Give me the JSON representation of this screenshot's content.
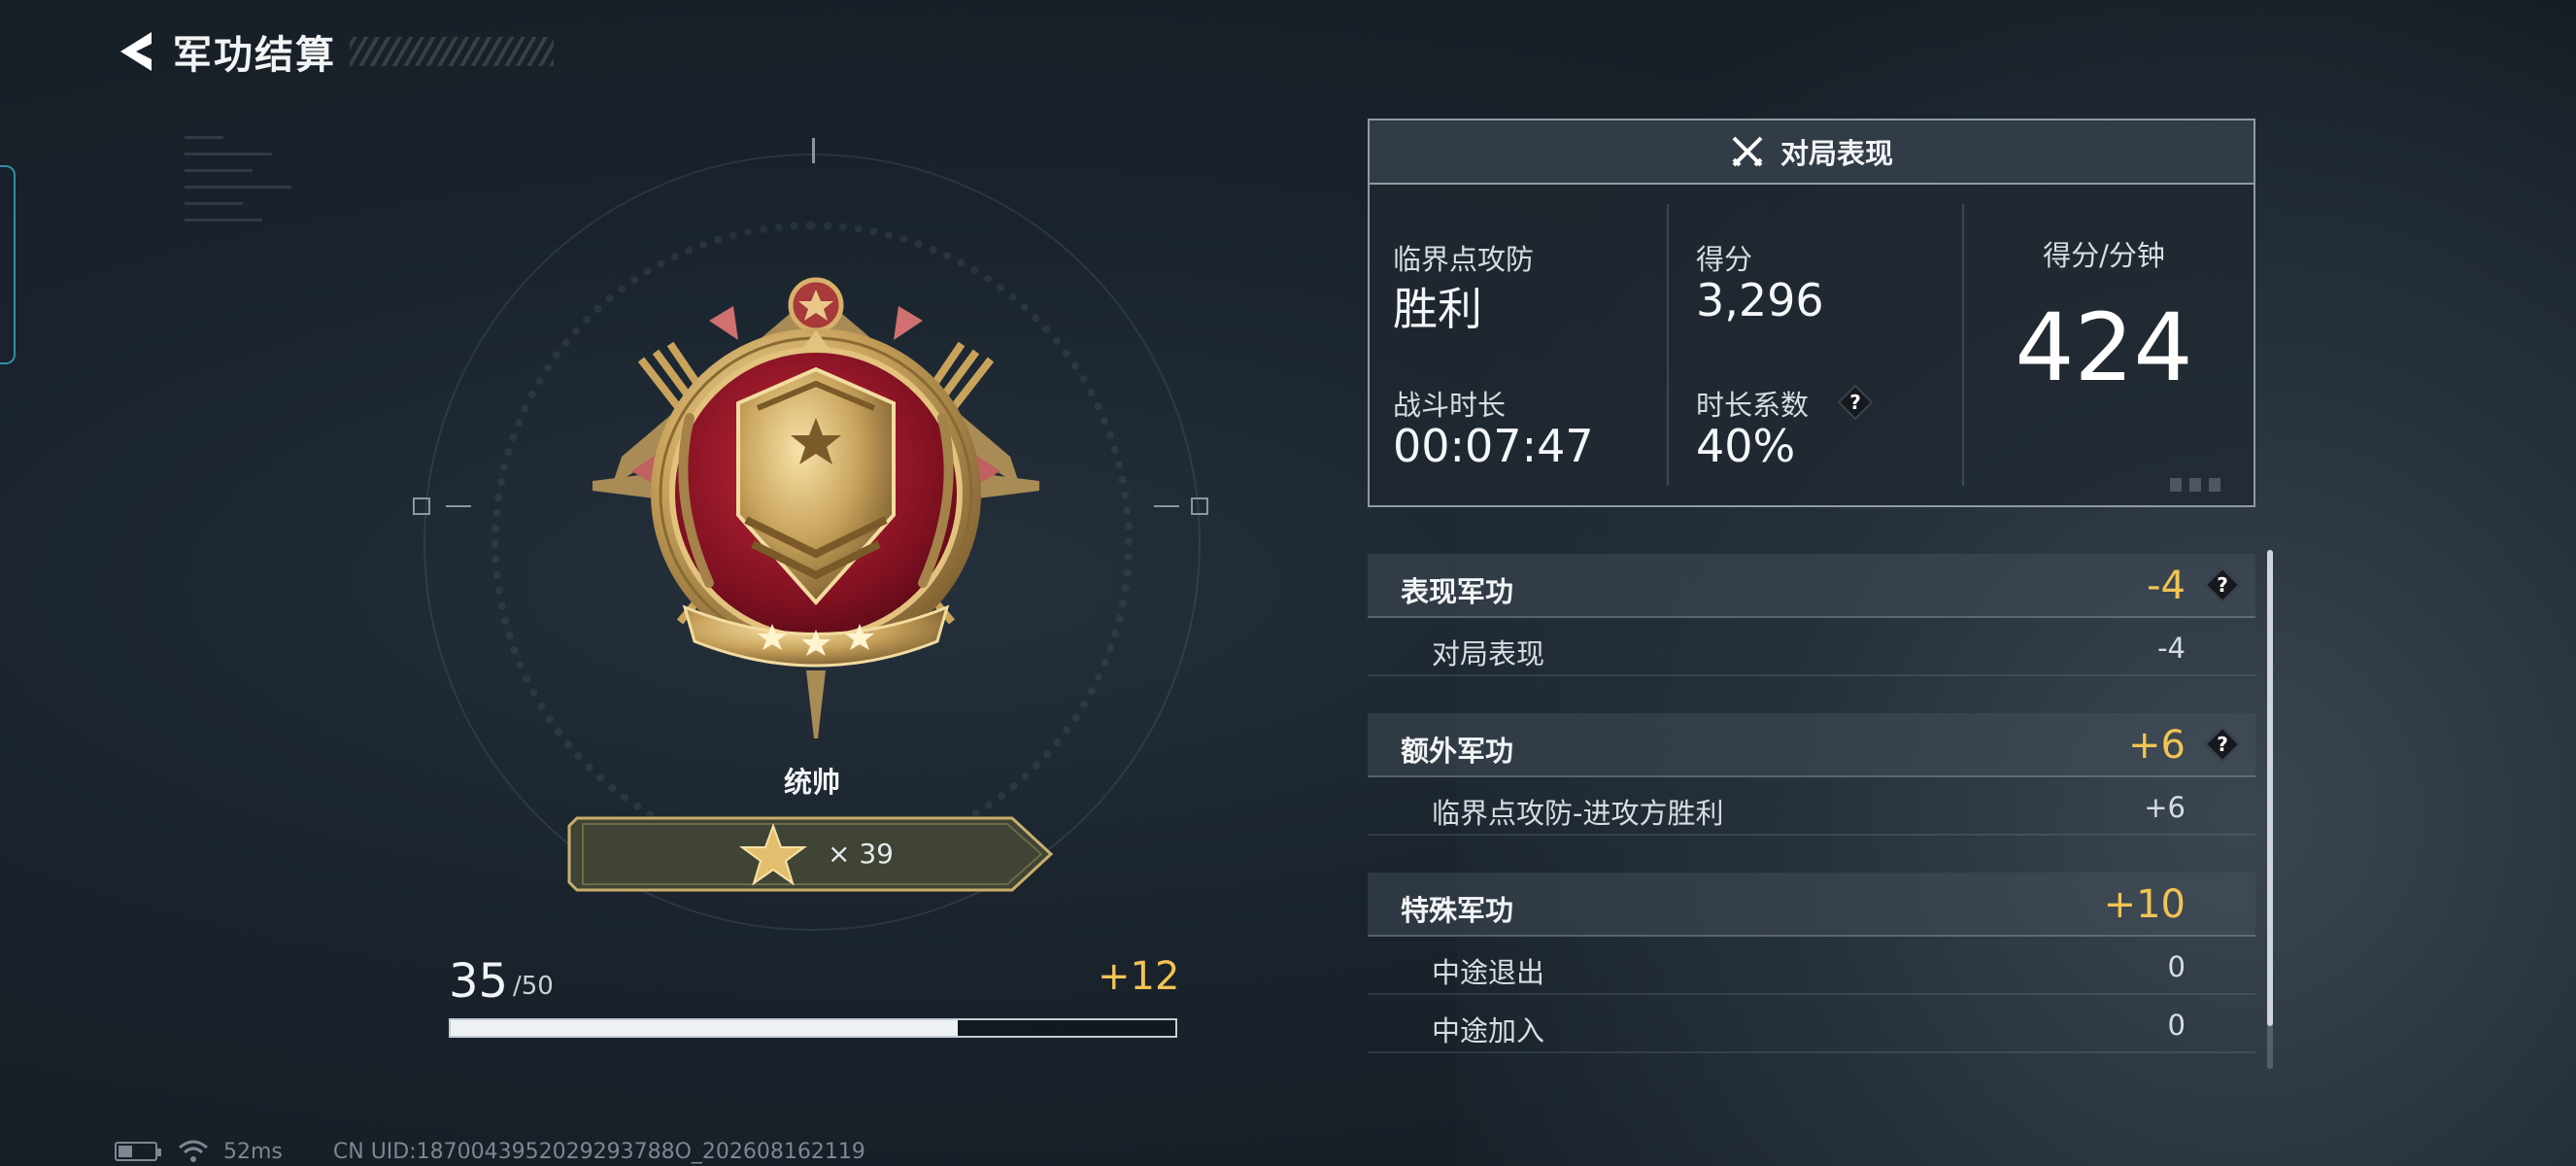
{
  "header": {
    "title": "军功结算",
    "back_icon": "back-arrow-icon"
  },
  "rank": {
    "name": "统帅",
    "stars_count": "× 39",
    "medal_icon": "marshal-medal-icon",
    "star_icon": "gold-star-icon"
  },
  "progress": {
    "current": "35",
    "total": "/50",
    "gain": "+12",
    "fraction": 0.7
  },
  "match": {
    "header_icon": "crossed-swords-icon",
    "title": "对局表现",
    "mode_label": "临界点攻防",
    "result": "胜利",
    "score_label": "得分",
    "score": "3,296",
    "duration_label": "战斗时长",
    "duration": "00:07:47",
    "coef_label": "时长系数",
    "coef": "40%",
    "ppm_label": "得分/分钟",
    "ppm": "424",
    "help": "?"
  },
  "merits": {
    "performance": {
      "title": "表现军功",
      "value": "-4",
      "items": [
        {
          "label": "对局表现",
          "value": "-4"
        }
      ]
    },
    "extra": {
      "title": "额外军功",
      "value": "+6",
      "items": [
        {
          "label": "临界点攻防-进攻方胜利",
          "value": "+6"
        }
      ]
    },
    "special": {
      "title": "特殊军功",
      "value": "+10",
      "items": [
        {
          "label": "中途退出",
          "value": "0"
        },
        {
          "label": "中途加入",
          "value": "0"
        }
      ]
    },
    "help": "?"
  },
  "footer": {
    "ping": "52ms",
    "uid": "CN UID:1870043952029293788O_202608162119"
  },
  "colors": {
    "accent_gold": "#f1c453",
    "panel_border": "#8f9aa5",
    "cyan_edge": "#2f8fa6"
  }
}
